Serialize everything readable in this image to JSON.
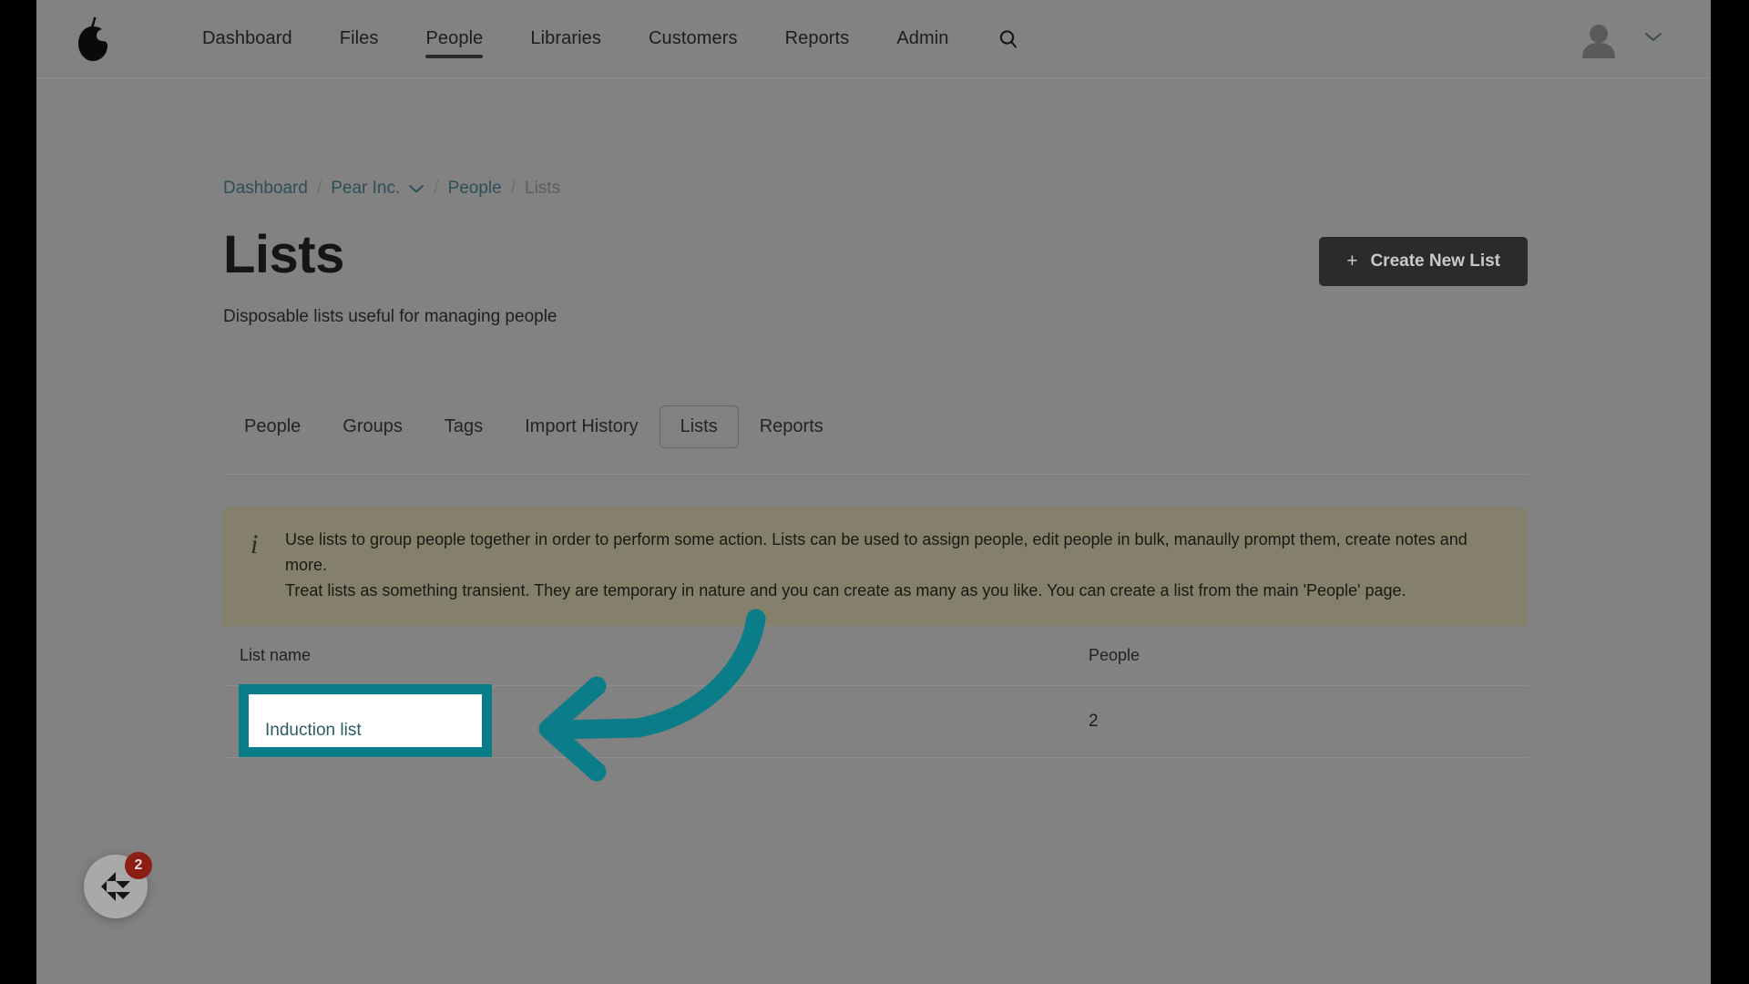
{
  "app": {
    "logo_icon": "pear-logo-icon"
  },
  "nav": {
    "items": [
      {
        "label": "Dashboard",
        "active": false
      },
      {
        "label": "Files",
        "active": false
      },
      {
        "label": "People",
        "active": true
      },
      {
        "label": "Libraries",
        "active": false
      },
      {
        "label": "Customers",
        "active": false
      },
      {
        "label": "Reports",
        "active": false
      },
      {
        "label": "Admin",
        "active": false
      }
    ],
    "search_icon": "search-icon",
    "avatar_icon": "user-avatar-icon",
    "account_chevron_icon": "chevron-down-icon"
  },
  "breadcrumb": {
    "dashboard": "Dashboard",
    "org": "Pear Inc.",
    "org_chevron_icon": "chevron-down-icon",
    "people": "People",
    "current": "Lists",
    "separator": "/"
  },
  "page": {
    "title": "Lists",
    "subtitle": "Disposable lists useful for managing people",
    "create_button": {
      "plus": "+",
      "label": "Create New List"
    }
  },
  "tabs": [
    {
      "label": "People",
      "selected": false
    },
    {
      "label": "Groups",
      "selected": false
    },
    {
      "label": "Tags",
      "selected": false
    },
    {
      "label": "Import History",
      "selected": false
    },
    {
      "label": "Lists",
      "selected": true
    },
    {
      "label": "Reports",
      "selected": false
    }
  ],
  "banner": {
    "icon": "info-icon",
    "line1": "Use lists to group people together in order to perform some action. Lists can be used to assign people, edit people in bulk, manaully prompt them, create notes and more.",
    "line2": "Treat lists as something transient. They are temporary in nature and you can create as many as you like. You can create a list from the main 'People' page."
  },
  "table": {
    "columns": [
      "List name",
      "People"
    ],
    "rows": [
      {
        "name": "Induction list",
        "people": "2"
      }
    ]
  },
  "annotation": {
    "arrow_icon": "curved-left-arrow-icon",
    "highlight_target": "Induction list",
    "color": "#0b7d89"
  },
  "chat_widget": {
    "icon": "chat-bubble-icon",
    "badge_count": "2"
  },
  "colors": {
    "accent_teal": "#0b7d89",
    "link": "#2c5b63",
    "banner_bg": "#85806b",
    "button_bg": "#2b2b2b",
    "badge_red": "#8c1f15"
  }
}
